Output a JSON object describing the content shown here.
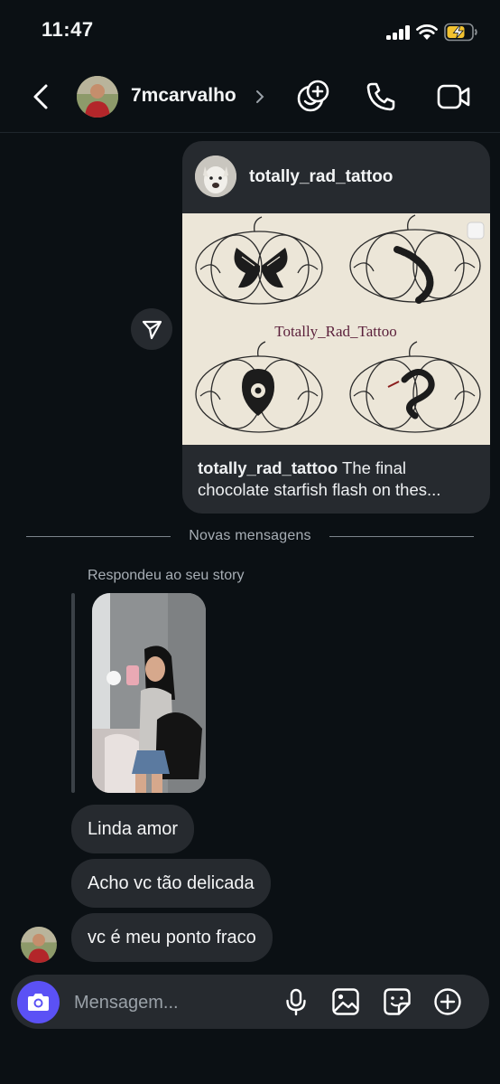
{
  "status_bar": {
    "time": "11:47",
    "battery_color": "#f2c230"
  },
  "header": {
    "username": "7mcarvalho",
    "icons": [
      "back-arrow-icon",
      "chevron-right-icon",
      "add-people-icon",
      "phone-icon",
      "video-camera-icon"
    ]
  },
  "shared_post": {
    "author": "totally_rad_tattoo",
    "image_title": "Totally_Rad_Tattoo",
    "caption_user": "totally_rad_tattoo",
    "caption_text": " The final chocolate starfish flash on thes..."
  },
  "divider": {
    "label": "Novas mensagens"
  },
  "story_reply": {
    "label": "Respondeu ao seu story"
  },
  "messages": [
    {
      "text": "Linda amor"
    },
    {
      "text": "Acho vc tão delicada"
    },
    {
      "text": "vc é meu ponto fraco"
    }
  ],
  "composer": {
    "placeholder": "Mensagem...",
    "camera_button_color": "#5b51f5",
    "icons": [
      "microphone-icon",
      "gallery-icon",
      "sticker-icon",
      "add-icon"
    ]
  }
}
